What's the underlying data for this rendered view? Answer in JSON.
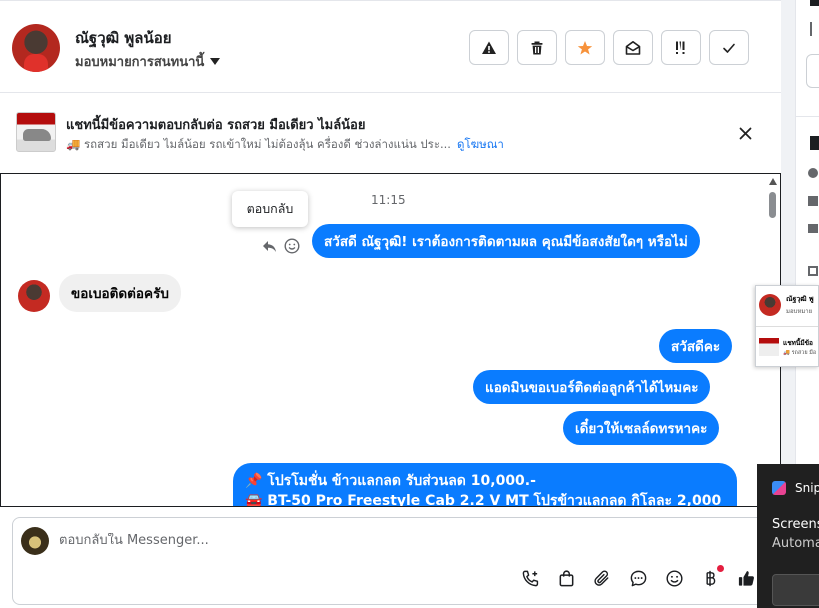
{
  "header": {
    "contact_name": "ณัฐวุฒิ พูลน้อย",
    "assign_label": "มอบหมายการสนทนานี้",
    "actions": [
      {
        "name": "warning",
        "icon": "warning-icon"
      },
      {
        "name": "delete",
        "icon": "trash-icon"
      },
      {
        "name": "star",
        "icon": "star-icon"
      },
      {
        "name": "mark-unread",
        "icon": "envelope-open-icon"
      },
      {
        "name": "follow-up",
        "icon": "exclamation-icon"
      },
      {
        "name": "done",
        "icon": "check-icon"
      }
    ]
  },
  "ad_banner": {
    "title": "แชทนี้มีข้อความตอบกลับต่อ รถสวย มือเดียว ไมล์น้อย",
    "description": "🚚 รถสวย มือเดียว ไมล์น้อย รถเข้าใหม่ ไม่ต้องลุ้น ครื่องดี ช่วงล่างแน่น ประ...",
    "link_label": "ดูโฆษณา"
  },
  "chat": {
    "timestamp": "11:15",
    "tooltip": "ตอบกลับ",
    "messages": [
      {
        "direction": "out",
        "text": "สวัสดี ณัฐวุฒิ! เราต้องการติดตามผล คุณมีข้อสงสัยใดๆ หรือไม่"
      },
      {
        "direction": "in",
        "text": "ขอเบอติดต่อครับ"
      },
      {
        "direction": "out",
        "text": "สวัสดีคะ"
      },
      {
        "direction": "out",
        "text": "แอดมินขอเบอร์ติดต่อลูกค้าได้ไหมคะ"
      },
      {
        "direction": "out",
        "text": "เดี๋ยวให้เซลล์ดทรหาคะ"
      }
    ],
    "promo": {
      "line1": "📌 โปรโมชั่น ข้าวแลกลด รับส่วนลด 10,000.-",
      "line2": "🚘 BT-50 Pro Freestyle Cab 2.2 V MT โปรข้าวแลกลด กิโลละ 2,000"
    }
  },
  "composer": {
    "placeholder": "ตอบกลับใน Messenger...",
    "tools": [
      "call-plus-icon",
      "shopping-bag-icon",
      "paperclip-icon",
      "chat-bubble-icon",
      "smiley-icon",
      "baht-icon",
      "thumbs-up-icon"
    ]
  },
  "overlays": {
    "thumb_name": "ณัฐวุฒิ พู",
    "thumb_sub": "มอบหมาย",
    "thumb_ad": "แชทนี้มีข้อ",
    "thumb_ad_sub": "🚚 รถสวย มือ",
    "snip_title": "Snip",
    "snip_line1": "Screens",
    "snip_line2": "Automa"
  },
  "colors": {
    "accent": "#0a7cff",
    "incoming": "#f0f0f0",
    "star": "#f7923b"
  }
}
